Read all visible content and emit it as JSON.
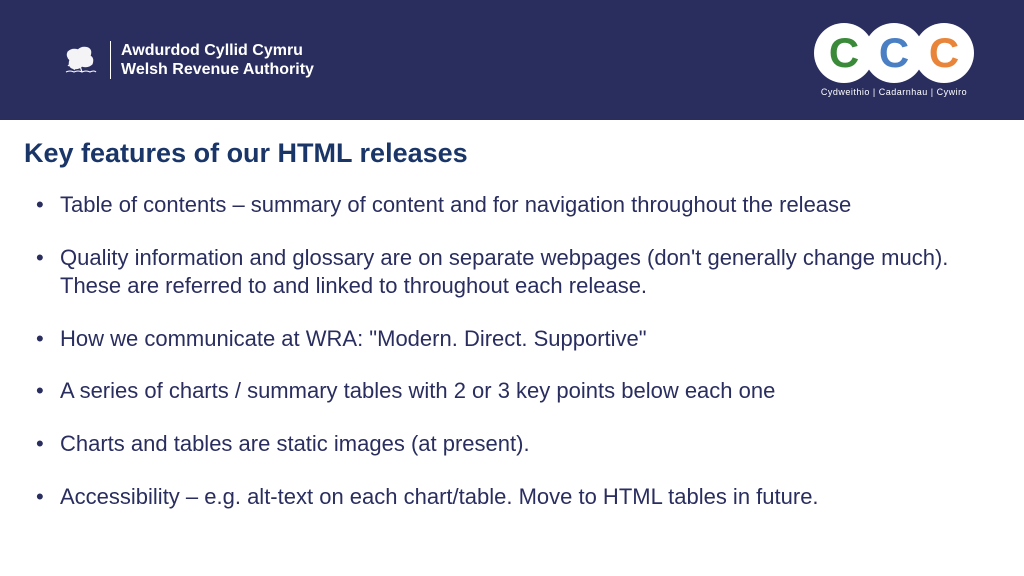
{
  "header": {
    "org_name_cy": "Awdurdod Cyllid Cymru",
    "org_name_en": "Welsh Revenue Authority",
    "tagline": "Cydweithio | Cadarnhau | Cywiro"
  },
  "content": {
    "title": "Key features of our HTML releases",
    "bullets": [
      "Table of contents – summary of content and for navigation throughout the release",
      "Quality information and glossary are on separate webpages (don't generally change much). These are referred to and linked to throughout each release.",
      "How we communicate at WRA: \"Modern. Direct. Supportive\"",
      "A series of charts / summary tables with 2 or 3 key points below each one",
      "Charts and tables are static images (at present).",
      "Accessibility – e.g. alt-text on each chart/table. Move to HTML tables in future."
    ]
  }
}
